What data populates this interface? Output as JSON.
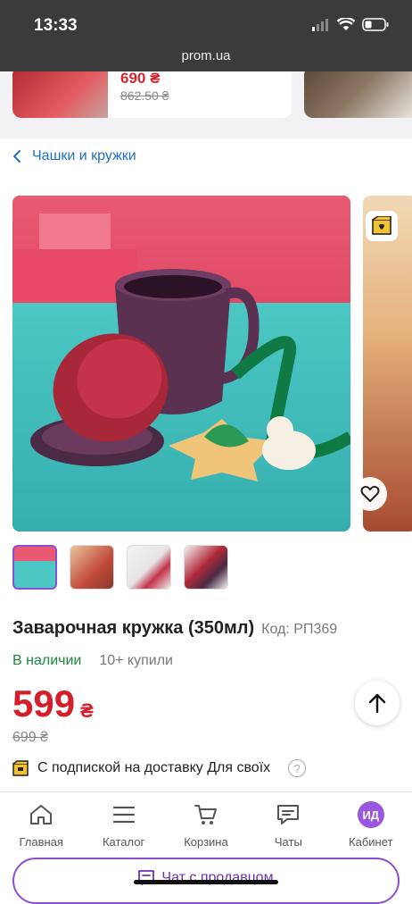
{
  "status": {
    "time": "13:33",
    "domain": "prom.ua"
  },
  "prev_card": {
    "price": "690 ₴",
    "old_price": "862.50 ₴"
  },
  "breadcrumb": {
    "label": "Чашки и кружки"
  },
  "product": {
    "title": "Заварочная кружка (350мл)",
    "code": "Код: РП369",
    "stock": "В наличии",
    "bought": "10+ купили",
    "price": "599",
    "currency": "₴",
    "old_price": "699 ₴",
    "subscription": "С подпиской на доставку Для своїх",
    "help": "?"
  },
  "thumbnails": [
    {
      "name": "thumb-1",
      "active": true
    },
    {
      "name": "thumb-2",
      "active": false
    },
    {
      "name": "thumb-3",
      "active": false
    },
    {
      "name": "thumb-4",
      "active": false
    }
  ],
  "tabs": [
    {
      "label": "Главная",
      "icon": "home-icon"
    },
    {
      "label": "Каталог",
      "icon": "menu-icon"
    },
    {
      "label": "Корзина",
      "icon": "cart-icon"
    },
    {
      "label": "Чаты",
      "icon": "chat-icon"
    },
    {
      "label": "Кабинет",
      "icon": "avatar",
      "avatar_text": "ИД"
    }
  ],
  "chat_button": {
    "label": "Чат с продавцом"
  },
  "colors": {
    "accent": "#8a4fd6",
    "price": "#d41f2b",
    "link": "#1f6fc4",
    "stock": "#1a8a3a"
  }
}
